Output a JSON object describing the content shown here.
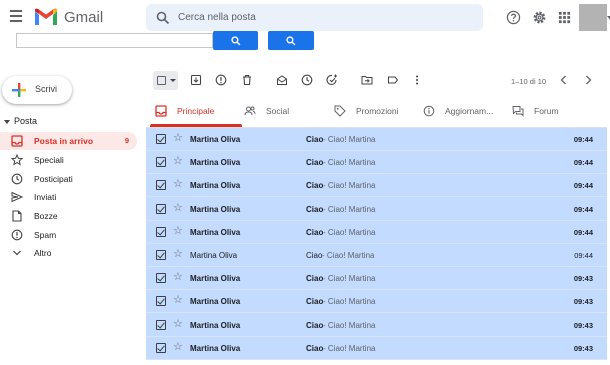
{
  "app": {
    "name": "Gmail"
  },
  "header": {
    "search_placeholder": "Cerca nella posta",
    "icons": [
      "menu-icon",
      "search-icon",
      "search-options-icon",
      "help-icon",
      "settings-icon",
      "apps-icon",
      "avatar"
    ]
  },
  "colors": {
    "accent": "#d93025",
    "selection": "#c2dbff",
    "primary_button": "#1a73e8"
  },
  "sidebar": {
    "compose_label": "Scrivi",
    "section_title": "Posta",
    "items": [
      {
        "label": "Posta in arrivo",
        "count": "9",
        "icon": "inbox-icon",
        "active": true
      },
      {
        "label": "Speciali",
        "count": "",
        "icon": "star-icon",
        "active": false
      },
      {
        "label": "Posticipati",
        "count": "",
        "icon": "clock-icon",
        "active": false
      },
      {
        "label": "Inviati",
        "count": "",
        "icon": "send-icon",
        "active": false
      },
      {
        "label": "Bozze",
        "count": "",
        "icon": "draft-icon",
        "active": false
      },
      {
        "label": "Spam",
        "count": "",
        "icon": "spam-icon",
        "active": false
      },
      {
        "label": "Altro",
        "count": "",
        "icon": "chevron-down-icon",
        "active": false
      }
    ]
  },
  "toolbar": {
    "pager_text": "1–10 di 10"
  },
  "tabs": [
    {
      "label": "Principale",
      "icon": "inbox-icon",
      "active": true
    },
    {
      "label": "Social",
      "icon": "people-icon",
      "active": false
    },
    {
      "label": "Promozioni",
      "icon": "tag-icon",
      "active": false
    },
    {
      "label": "Aggiornam...",
      "icon": "info-icon",
      "active": false
    },
    {
      "label": "Forum",
      "icon": "forum-icon",
      "active": false
    }
  ],
  "emails": [
    {
      "sender": "Martina Oliva",
      "subject": "Ciao",
      "snippet": " - Ciao! Martina",
      "time": "09:44",
      "unread": true
    },
    {
      "sender": "Martina Oliva",
      "subject": "Ciao",
      "snippet": " - Ciao! Martina",
      "time": "09:44",
      "unread": true
    },
    {
      "sender": "Martina Oliva",
      "subject": "Ciao",
      "snippet": " - Ciao! Martina",
      "time": "09:44",
      "unread": true
    },
    {
      "sender": "Martina Oliva",
      "subject": "Ciao",
      "snippet": " - Ciao! Martina",
      "time": "09:44",
      "unread": true
    },
    {
      "sender": "Martina Oliva",
      "subject": "Ciao",
      "snippet": " - Ciao! Martina",
      "time": "09:44",
      "unread": true
    },
    {
      "sender": "Martina Oliva",
      "subject": "Ciao",
      "snippet": " - Ciao! Martina",
      "time": "09:44",
      "unread": false
    },
    {
      "sender": "Martina Oliva",
      "subject": "Ciao",
      "snippet": " - Ciao! Martina",
      "time": "09:43",
      "unread": true
    },
    {
      "sender": "Martina Oliva",
      "subject": "Ciao",
      "snippet": " - Ciao! Martina",
      "time": "09:43",
      "unread": true
    },
    {
      "sender": "Martina Oliva",
      "subject": "Ciao",
      "snippet": " - Ciao! Martina",
      "time": "09:43",
      "unread": true
    },
    {
      "sender": "Martina Oliva",
      "subject": "Ciao",
      "snippet": " - Ciao! Martina",
      "time": "09:43",
      "unread": true
    }
  ]
}
